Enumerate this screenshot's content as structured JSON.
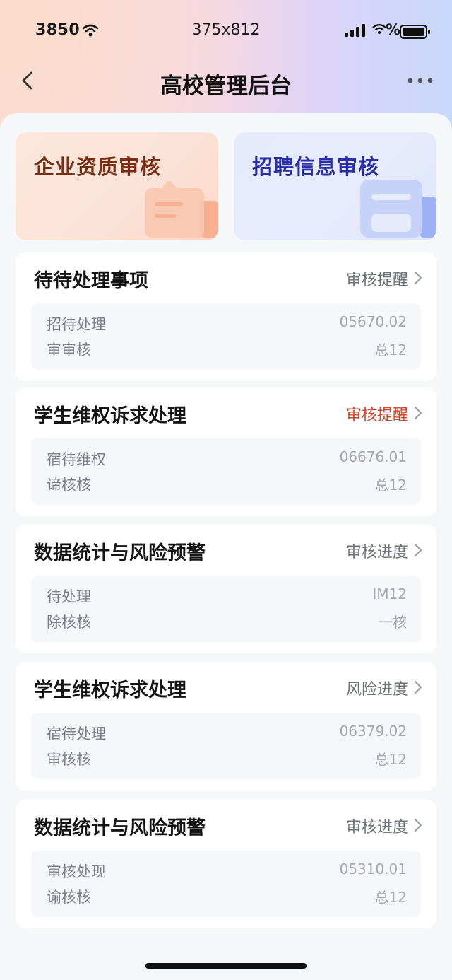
{
  "status_bar": {
    "time": "3850",
    "center_text": "375x812",
    "battery_text": "%"
  },
  "nav": {
    "title": "高校管理后台"
  },
  "feature_cards": [
    {
      "title": "企业资质审核",
      "accent": "#7a2f14"
    },
    {
      "title": "招聘信息审核",
      "accent": "#2a2fa8"
    }
  ],
  "sections": [
    {
      "title": "待待处理事项",
      "link": "审核提醒",
      "link_alert": false,
      "rows": [
        {
          "label": "招待处理",
          "value": "05670.02"
        },
        {
          "label": "审审核",
          "value": "总12"
        }
      ]
    },
    {
      "title": "学生维权诉求处理",
      "link": "审核提醒",
      "link_alert": true,
      "rows": [
        {
          "label": "宿待维权",
          "value": "06676.01"
        },
        {
          "label": "谛核核",
          "value": "总12"
        }
      ]
    },
    {
      "title": "数据统计与风险预警",
      "link": "审核进度",
      "link_alert": false,
      "rows": [
        {
          "label": "待处理",
          "value": "IM12"
        },
        {
          "label": "除核核",
          "value": "一核"
        }
      ]
    },
    {
      "title": "学生维权诉求处理",
      "link": "风险进度",
      "link_alert": false,
      "rows": [
        {
          "label": "宿待处理",
          "value": "06379.02"
        },
        {
          "label": "审核核",
          "value": "总12"
        }
      ]
    },
    {
      "title": "数据统计与风险预警",
      "link": "审核进度",
      "link_alert": false,
      "rows": [
        {
          "label": "审核处现",
          "value": "05310.01"
        },
        {
          "label": "谕核核",
          "value": "总12"
        }
      ]
    }
  ],
  "colors": {
    "alert": "#d9422e",
    "link": "#6f7278"
  },
  "icons": [
    "wifi-icon",
    "signal-icon",
    "battery-icon",
    "back-arrow-icon",
    "more-icon",
    "chevron-right-icon",
    "document-icon"
  ]
}
